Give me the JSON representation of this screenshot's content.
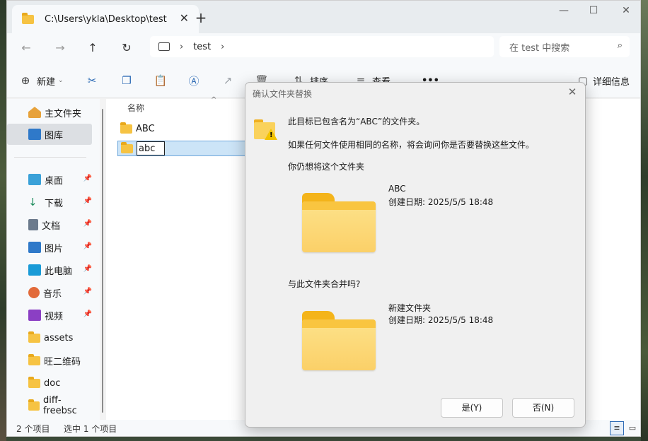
{
  "window": {
    "tab_title": "C:\\Users\\ykla\\Desktop\\test",
    "tab_close": "✕",
    "new_tab": "+"
  },
  "window_controls": {
    "minimize": "—",
    "maximize": "☐",
    "close": "✕"
  },
  "nav": {
    "back": "←",
    "forward": "→",
    "up": "↑",
    "refresh": "↻",
    "breadcrumb": [
      "test"
    ],
    "search_placeholder": "在 test 中搜索"
  },
  "toolbar": {
    "new_label": "新建",
    "sort_label": "排序",
    "view_label": "查看",
    "more": "•••",
    "details_label": "详细信息"
  },
  "sidebar": {
    "items": [
      {
        "label": "主文件夹",
        "icon": "home-icon",
        "pinned": false,
        "selected": false
      },
      {
        "label": "图库",
        "icon": "gallery-icon",
        "pinned": false,
        "selected": true
      },
      {
        "label": "桌面",
        "icon": "desktop-icon",
        "pinned": true,
        "selected": false
      },
      {
        "label": "下载",
        "icon": "download-icon",
        "pinned": true,
        "selected": false
      },
      {
        "label": "文档",
        "icon": "document-icon",
        "pinned": true,
        "selected": false
      },
      {
        "label": "图片",
        "icon": "pictures-icon",
        "pinned": true,
        "selected": false
      },
      {
        "label": "此电脑",
        "icon": "computer-icon",
        "pinned": true,
        "selected": false
      },
      {
        "label": "音乐",
        "icon": "music-icon",
        "pinned": true,
        "selected": false
      },
      {
        "label": "视频",
        "icon": "video-icon",
        "pinned": true,
        "selected": false
      },
      {
        "label": "assets",
        "icon": "folder-icon",
        "pinned": false,
        "selected": false
      },
      {
        "label": "旺二维码",
        "icon": "folder-icon",
        "pinned": false,
        "selected": false
      },
      {
        "label": "doc",
        "icon": "folder-icon",
        "pinned": false,
        "selected": false
      },
      {
        "label": "diff-freebsc",
        "icon": "folder-icon",
        "pinned": false,
        "selected": false
      }
    ]
  },
  "file_list": {
    "column_name": "名称",
    "rows": [
      {
        "name": "ABC",
        "selected": false
      },
      {
        "name": "abc",
        "selected": true,
        "renaming": true
      }
    ]
  },
  "status": {
    "item_count": "2 个项目",
    "selection": "选中 1 个项目"
  },
  "dialog": {
    "title": "确认文件夹替换",
    "close": "✕",
    "message": "此目标已包含名为“ABC”的文件夹。",
    "detail": "如果任何文件使用相同的名称，将会询问你是否要替换这些文件。",
    "prompt_keep": "你仍想将这个文件夹",
    "existing": {
      "name": "ABC",
      "created": "创建日期: 2025/5/5 18:48"
    },
    "prompt_merge": "与此文件夹合并吗?",
    "incoming": {
      "name": "新建文件夹",
      "created": "创建日期: 2025/5/5 18:48"
    },
    "yes_button": "是(Y)",
    "no_button": "否(N)"
  },
  "colors": {
    "accent": "#2d6bb5",
    "folder": "#f6c343",
    "selection": "#cce4f7"
  }
}
